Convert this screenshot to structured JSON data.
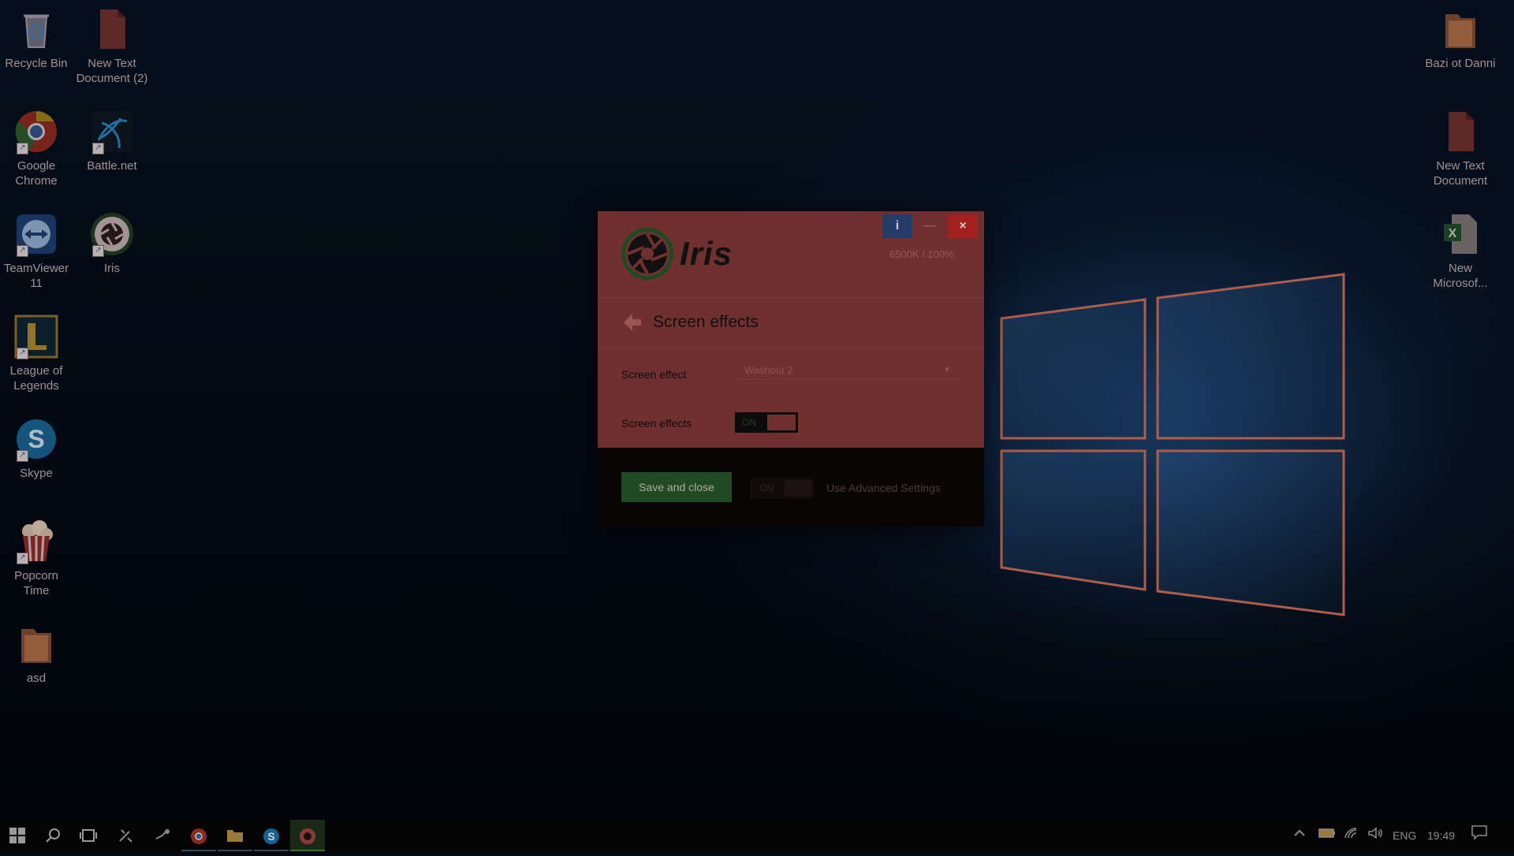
{
  "desktop": {
    "left_icons": [
      {
        "label": "Recycle Bin",
        "icon": "recycle-bin-icon"
      },
      {
        "label": "New Text Document (2)",
        "icon": "text-document-icon"
      },
      {
        "label": "Google Chrome",
        "icon": "chrome-icon"
      },
      {
        "label": "Battle.net",
        "icon": "battlenet-icon"
      },
      {
        "label": "TeamViewer 11",
        "icon": "teamviewer-icon"
      },
      {
        "label": "Iris",
        "icon": "iris-icon"
      },
      {
        "label": "League of Legends",
        "icon": "league-of-legends-icon"
      },
      {
        "label": "Skype",
        "icon": "skype-icon"
      },
      {
        "label": "Popcorn Time",
        "icon": "popcorn-time-icon"
      },
      {
        "label": "asd",
        "icon": "folder-icon"
      }
    ],
    "right_icons": [
      {
        "label": "Bazi ot Danni",
        "icon": "folder-icon"
      },
      {
        "label": "New Text Document",
        "icon": "text-document-icon"
      },
      {
        "label": "New Microsof...",
        "icon": "excel-icon"
      }
    ]
  },
  "dialog": {
    "info_button": "i",
    "minimize_button": "—",
    "close_button": "×",
    "brand": "Iris",
    "readout": "6500K / 100%",
    "section_title": "Screen effects",
    "screen_effect_label": "Screen effect",
    "screen_effect_value": "Washout 2",
    "screen_effects_toggle_label": "Screen effects",
    "screen_effects_toggle_state": "ON",
    "save_button": "Save and close",
    "advanced_toggle_state": "ON",
    "advanced_label": "Use Advanced Settings"
  },
  "taskbar": {
    "language": "ENG",
    "time": "19:49"
  },
  "colors": {
    "dialog_bg": "#6f302f",
    "save_button": "#1f4a22",
    "close_button": "#a3201e",
    "info_button": "#233c6a"
  }
}
